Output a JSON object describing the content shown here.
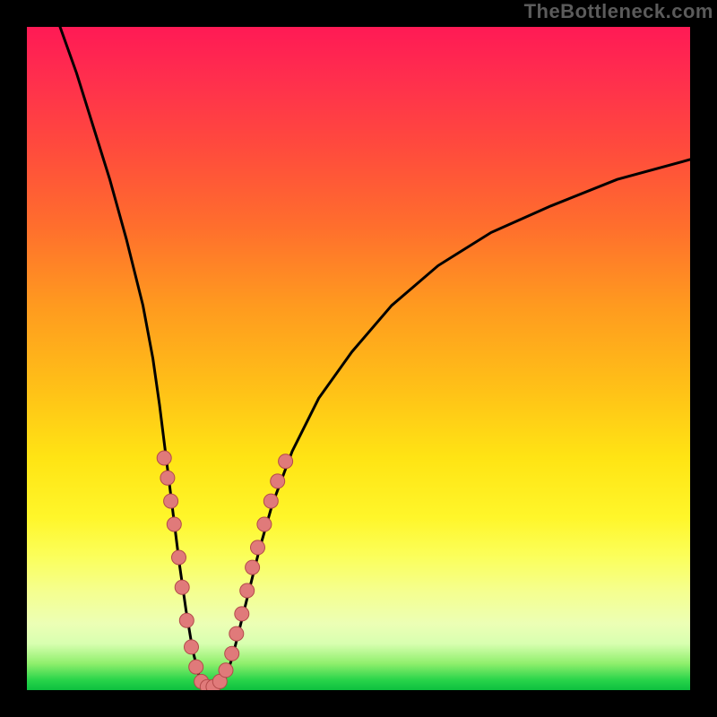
{
  "watermark": "TheBottleneck.com",
  "chart_data": {
    "type": "line",
    "title": "",
    "xlabel": "",
    "ylabel": "",
    "x_range": [
      0,
      1
    ],
    "y_range": [
      0,
      1
    ],
    "curve": [
      {
        "x": 0.05,
        "y": 1.0
      },
      {
        "x": 0.075,
        "y": 0.93
      },
      {
        "x": 0.1,
        "y": 0.85
      },
      {
        "x": 0.125,
        "y": 0.77
      },
      {
        "x": 0.15,
        "y": 0.68
      },
      {
        "x": 0.175,
        "y": 0.58
      },
      {
        "x": 0.19,
        "y": 0.5
      },
      {
        "x": 0.2,
        "y": 0.43
      },
      {
        "x": 0.21,
        "y": 0.35
      },
      {
        "x": 0.22,
        "y": 0.27
      },
      {
        "x": 0.23,
        "y": 0.19
      },
      {
        "x": 0.24,
        "y": 0.12
      },
      {
        "x": 0.25,
        "y": 0.06
      },
      {
        "x": 0.26,
        "y": 0.02
      },
      {
        "x": 0.27,
        "y": 0.005
      },
      {
        "x": 0.28,
        "y": 0.002
      },
      {
        "x": 0.29,
        "y": 0.005
      },
      {
        "x": 0.3,
        "y": 0.02
      },
      {
        "x": 0.31,
        "y": 0.05
      },
      {
        "x": 0.32,
        "y": 0.09
      },
      {
        "x": 0.335,
        "y": 0.15
      },
      {
        "x": 0.35,
        "y": 0.21
      },
      {
        "x": 0.37,
        "y": 0.28
      },
      {
        "x": 0.4,
        "y": 0.36
      },
      {
        "x": 0.44,
        "y": 0.44
      },
      {
        "x": 0.49,
        "y": 0.51
      },
      {
        "x": 0.55,
        "y": 0.58
      },
      {
        "x": 0.62,
        "y": 0.64
      },
      {
        "x": 0.7,
        "y": 0.69
      },
      {
        "x": 0.79,
        "y": 0.73
      },
      {
        "x": 0.89,
        "y": 0.77
      },
      {
        "x": 1.0,
        "y": 0.8
      }
    ],
    "series_points": [
      {
        "x": 0.207,
        "y": 0.35
      },
      {
        "x": 0.212,
        "y": 0.32
      },
      {
        "x": 0.217,
        "y": 0.285
      },
      {
        "x": 0.222,
        "y": 0.25
      },
      {
        "x": 0.229,
        "y": 0.2
      },
      {
        "x": 0.234,
        "y": 0.155
      },
      {
        "x": 0.241,
        "y": 0.105
      },
      {
        "x": 0.248,
        "y": 0.065
      },
      {
        "x": 0.255,
        "y": 0.035
      },
      {
        "x": 0.263,
        "y": 0.013
      },
      {
        "x": 0.272,
        "y": 0.005
      },
      {
        "x": 0.281,
        "y": 0.005
      },
      {
        "x": 0.291,
        "y": 0.013
      },
      {
        "x": 0.3,
        "y": 0.03
      },
      {
        "x": 0.309,
        "y": 0.055
      },
      {
        "x": 0.316,
        "y": 0.085
      },
      {
        "x": 0.324,
        "y": 0.115
      },
      {
        "x": 0.332,
        "y": 0.15
      },
      {
        "x": 0.34,
        "y": 0.185
      },
      {
        "x": 0.348,
        "y": 0.215
      },
      {
        "x": 0.358,
        "y": 0.25
      },
      {
        "x": 0.368,
        "y": 0.285
      },
      {
        "x": 0.378,
        "y": 0.315
      },
      {
        "x": 0.39,
        "y": 0.345
      }
    ],
    "colors": {
      "curve": "#000000",
      "points_fill": "#e07a7a",
      "points_stroke": "#b34a4a",
      "gradient_top": "#ff1a55",
      "gradient_bottom": "#0dbf3e"
    }
  }
}
